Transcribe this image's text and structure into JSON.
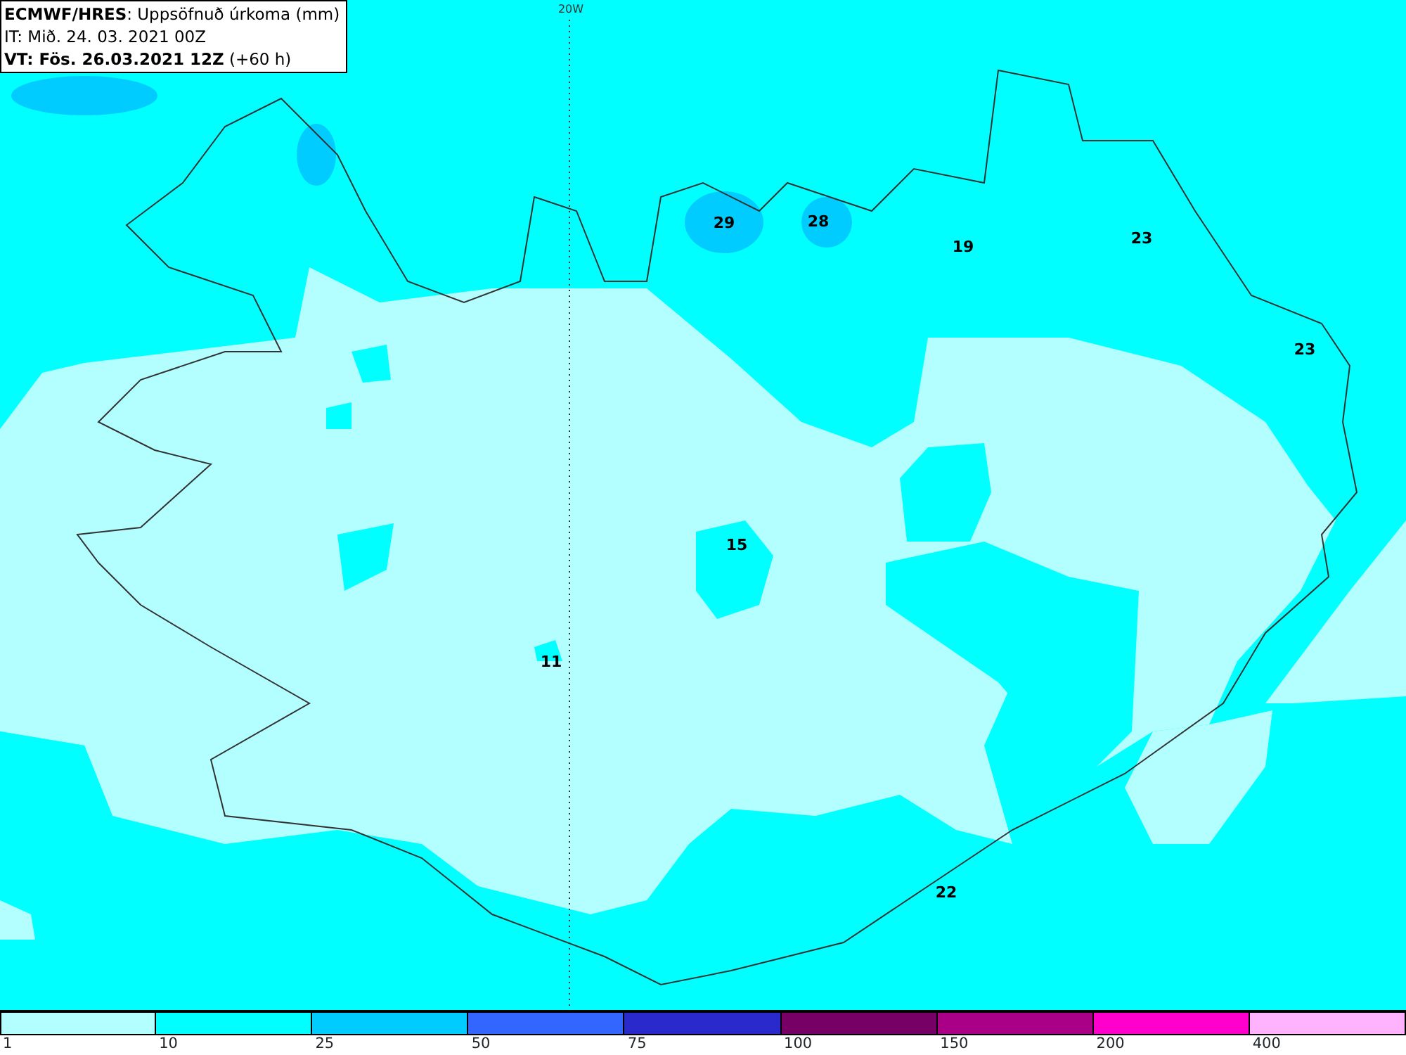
{
  "header": {
    "title": "**ECMWF/HRES**: Uppsöfnuð úrkoma (mm)",
    "issue_time": "IT: Mið. 24. 03. 2021 00Z",
    "valid_time": "**VT: Fös. 26.03.2021 12Z** (+60 h)"
  },
  "map": {
    "meridian_label": "20W",
    "values": [
      {
        "text": "29"
      },
      {
        "text": "28"
      },
      {
        "text": "19"
      },
      {
        "text": "23"
      },
      {
        "text": "23"
      },
      {
        "text": "15"
      },
      {
        "text": "11"
      },
      {
        "text": "22"
      }
    ]
  },
  "legend": {
    "bins": [
      {
        "color": "#b3ffff",
        "label": "1"
      },
      {
        "color": "#00ffff",
        "label": "10"
      },
      {
        "color": "#00ccff",
        "label": "25"
      },
      {
        "color": "#3366ff",
        "label": "50"
      },
      {
        "color": "#2a2acc",
        "label": "75"
      },
      {
        "color": "#770066",
        "label": "100"
      },
      {
        "color": "#aa0088",
        "label": "150"
      },
      {
        "color": "#ff00cc",
        "label": "200"
      },
      {
        "color": "#ffb3ff",
        "label": "400"
      }
    ]
  }
}
